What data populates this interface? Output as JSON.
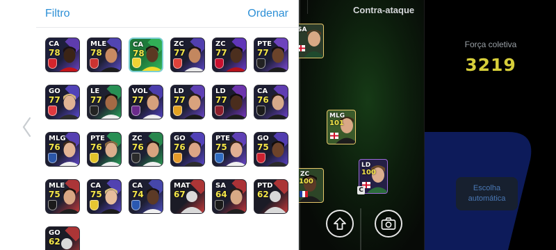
{
  "panel": {
    "filter_label": "Filtro",
    "sort_label": "Ordenar"
  },
  "players": [
    {
      "pos": "CA",
      "ovr": "78",
      "bg": "#1d1f3b",
      "accent": "#6a42c2",
      "skin": "#3b2416",
      "hair": "#1a1010",
      "badge": "#d4252c",
      "kit": "#c2141a"
    },
    {
      "pos": "MLE",
      "ovr": "78",
      "bg": "#1e1f33",
      "accent": "#5b4cc8",
      "skin": "#c98a62",
      "hair": "#2a1a12",
      "badge": "#cc3331",
      "kit": "#1d1d1d"
    },
    {
      "pos": "CA",
      "ovr": "78",
      "bg": "#1f7a3b",
      "accent": "#35b85c",
      "skin": "#5b3822",
      "hair": "#1e130e",
      "badge": "#f0d233",
      "kit": "#f3dc2b",
      "selected": true
    },
    {
      "pos": "ZC",
      "ovr": "77",
      "bg": "#1b1c2e",
      "accent": "#5a45c4",
      "skin": "#c3875f",
      "hair": "#1d120d",
      "badge": "#e0423a",
      "kit": "#e8e8e8"
    },
    {
      "pos": "ZC",
      "ovr": "77",
      "bg": "#1d1d30",
      "accent": "#6c3bd0",
      "skin": "#4c2f1e",
      "hair": "#120c09",
      "badge": "#c8102e",
      "kit": "#b5121b"
    },
    {
      "pos": "PTE",
      "ovr": "77",
      "bg": "#1c1d34",
      "accent": "#7b4ad6",
      "skin": "#6b432a",
      "hair": "#15100c",
      "badge": "#222222",
      "kit": "#1d1d1d"
    },
    {
      "pos": "GO",
      "ovr": "77",
      "bg": "#1b1c33",
      "accent": "#5a49cf",
      "skin": "#e0b394",
      "hair": "#d8b778",
      "badge": "#e1393f",
      "kit": "#2d2d2d"
    },
    {
      "pos": "LE",
      "ovr": "77",
      "bg": "#1f2130",
      "accent": "#2aa35a",
      "skin": "#a46a45",
      "hair": "#1b120c",
      "badge": "#222222",
      "kit": "#f0f0f0"
    },
    {
      "pos": "VOL",
      "ovr": "77",
      "bg": "#1b1c2f",
      "accent": "#5443c2",
      "skin": "#d5a07c",
      "hair": "#3a2518",
      "badge": "#6b2a8c",
      "kit": "#f0f0f0"
    },
    {
      "pos": "LD",
      "ovr": "77",
      "bg": "#1d1f32",
      "accent": "#6a46ca",
      "skin": "#d9a27d",
      "hair": "#2a1b12",
      "badge": "#e3a221",
      "kit": "#1b1b1b"
    },
    {
      "pos": "LD",
      "ovr": "77",
      "bg": "#1b1c2f",
      "accent": "#7a38c2",
      "skin": "#4a2d1d",
      "hair": "#120c09",
      "badge": "#8c1d2b",
      "kit": "#1d1d1d"
    },
    {
      "pos": "CA",
      "ovr": "76",
      "bg": "#1e1f35",
      "accent": "#6b42c7",
      "skin": "#d6a98a",
      "hair": "#2b1c12",
      "badge": "#1b1b1b",
      "kit": "#1e1e1e"
    },
    {
      "pos": "MLG",
      "ovr": "76",
      "bg": "#1c1d31",
      "accent": "#6047c9",
      "skin": "#e2b495",
      "hair": "#3d2818",
      "badge": "#2b56a8",
      "kit": "#f0f0f0"
    },
    {
      "pos": "PTE",
      "ovr": "76",
      "bg": "#1d1e30",
      "accent": "#2aa35a",
      "skin": "#dcae8d",
      "hair": "#8c6a3e",
      "badge": "#e3c42a",
      "kit": "#f0f0f0"
    },
    {
      "pos": "ZC",
      "ovr": "76",
      "bg": "#1d1f33",
      "accent": "#2a9a52",
      "skin": "#d8a37f",
      "hair": "#231710",
      "badge": "#2a2a2a",
      "kit": "#f0f0f0"
    },
    {
      "pos": "GO",
      "ovr": "76",
      "bg": "#1c1d33",
      "accent": "#5b48cf",
      "skin": "#dba585",
      "hair": "#2e1e14",
      "badge": "#e59a2a",
      "kit": "#2c2c2c"
    },
    {
      "pos": "PTE",
      "ovr": "75",
      "bg": "#1d1e32",
      "accent": "#6b46cc",
      "skin": "#e2b093",
      "hair": "#3b2516",
      "badge": "#2f6bc0",
      "kit": "#f0f0f0"
    },
    {
      "pos": "GO",
      "ovr": "75",
      "bg": "#1b1c2f",
      "accent": "#5a42c6",
      "skin": "#6d432a",
      "hair": "#140d09",
      "badge": "#cc2230",
      "kit": "#2b2b2b"
    },
    {
      "pos": "MLE",
      "ovr": "75",
      "bg": "#1e1f31",
      "accent": "#c43a3a",
      "skin": "#d9a784",
      "hair": "#1e130d",
      "badge": "#1b1b1b",
      "kit": "#1f1f1f"
    },
    {
      "pos": "CA",
      "ovr": "75",
      "bg": "#1c1d30",
      "accent": "#5a49c8",
      "skin": "#e6bd9c",
      "hair": "#d8c07e",
      "badge": "#e6c631",
      "kit": "#1b1b1b"
    },
    {
      "pos": "CA",
      "ovr": "74",
      "bg": "#1d1e31",
      "accent": "#4e4fc0",
      "skin": "#5c3a26",
      "hair": "#1a110c",
      "badge": "#2a58b0",
      "kit": "#f0f0f0"
    },
    {
      "pos": "MAT",
      "ovr": "67",
      "bg": "#1b1b26",
      "accent": "#c43a3a",
      "blank": true
    },
    {
      "pos": "SA",
      "ovr": "64",
      "bg": "#1b1c2d",
      "accent": "#c4363a",
      "skin": "#d7a985",
      "hair": "#2c1d13",
      "badge": "#1a1a1a",
      "kit": "#1f1f1f"
    },
    {
      "pos": "PTD",
      "ovr": "62",
      "bg": "#1b1b26",
      "accent": "#c43a3a",
      "blank": true
    },
    {
      "pos": "GO",
      "ovr": "62",
      "bg": "#1b1b26",
      "accent": "#c43a3a",
      "blank": true
    }
  ],
  "pitch": {
    "formation_label": "Contra-ataque",
    "cards": [
      {
        "pos": "SA",
        "ovr": "",
        "flag": "england"
      },
      {
        "pos": "MLG",
        "ovr": "101",
        "flag": "england"
      },
      {
        "pos": "LD",
        "ovr": "100",
        "flag": "england"
      },
      {
        "pos": "ZC",
        "ovr": "100",
        "flag": "france"
      }
    ],
    "captain_marker": "C"
  },
  "team": {
    "strength_label": "Força coletiva",
    "strength_value": "3219",
    "auto_label_line1": "Escolha",
    "auto_label_line2": "automática"
  },
  "colors": {
    "accent_link": "#2c8fd6",
    "rating_yellow": "#f4e64a",
    "strength_yellow": "#d6ce3a"
  },
  "icons": {
    "left_arrow": "chevron-left-icon",
    "up_arrow": "arrow-up-icon",
    "camera": "camera-icon"
  }
}
